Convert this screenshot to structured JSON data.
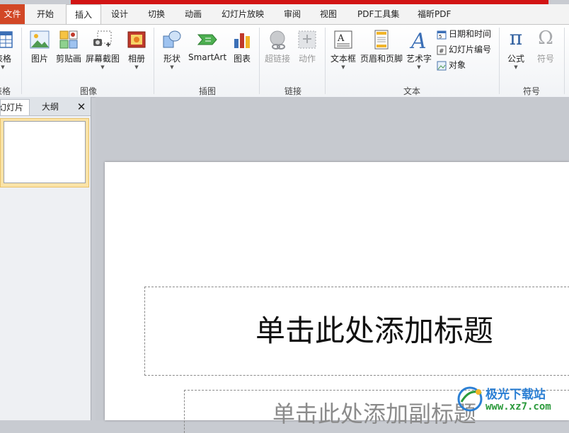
{
  "tabs": {
    "file": "文件",
    "home": "开始",
    "insert": "插入",
    "design": "设计",
    "transitions": "切换",
    "animations": "动画",
    "slideshow": "幻灯片放映",
    "review": "审阅",
    "view": "视图",
    "pdf_tools": "PDF工具集",
    "foxit_pdf": "福昕PDF"
  },
  "ribbon": {
    "table": {
      "button": "表格",
      "group": "表格"
    },
    "images": {
      "group": "图像",
      "picture": "图片",
      "clipart": "剪贴画",
      "screenshot": "屏幕截图",
      "album": "相册"
    },
    "illustrations": {
      "group": "插图",
      "shapes": "形状",
      "smartart": "SmartArt",
      "chart": "图表"
    },
    "links": {
      "group": "链接",
      "hyperlink": "超链接",
      "action": "动作"
    },
    "text": {
      "group": "文本",
      "textbox": "文本框",
      "header_footer": "页眉和页脚",
      "wordart": "艺术字",
      "datetime": "日期和时间",
      "slide_number": "幻灯片编号",
      "object": "对象"
    },
    "symbols": {
      "group": "符号",
      "equation": "公式",
      "symbol": "符号",
      "equation_glyph": "π",
      "symbol_glyph": "Ω"
    }
  },
  "left_panel": {
    "slides_tab": "幻灯片",
    "outline_tab": "大纲",
    "close": "✕"
  },
  "slide": {
    "title_placeholder": "单击此处添加标题",
    "subtitle_placeholder": "单击此处添加副标题"
  },
  "watermark": {
    "name": "极光下载站",
    "url": "www.xz7.com"
  },
  "colors": {
    "file_tab": "#d24726",
    "accent_red": "#d21414",
    "thumb_selected": "#fbe3a7"
  }
}
